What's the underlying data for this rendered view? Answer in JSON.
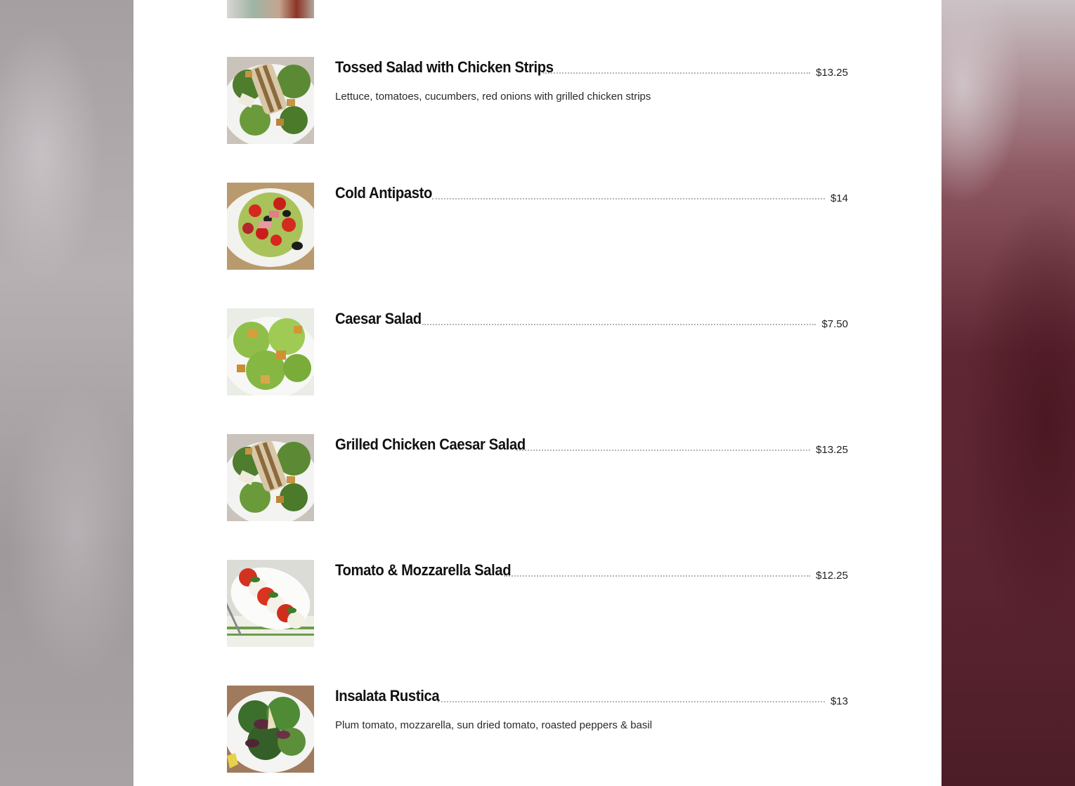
{
  "menu": {
    "items": [
      {
        "name": "Tossed Salad with Chicken Strips",
        "price": "$13.25",
        "description": "Lettuce, tomatoes, cucumbers, red onions with grilled chicken strips",
        "image": "chicken-caesar-photo"
      },
      {
        "name": "Cold Antipasto",
        "price": "$14",
        "description": "",
        "image": "antipasto-photo"
      },
      {
        "name": "Caesar Salad",
        "price": "$7.50",
        "description": "",
        "image": "caesar-salad-photo"
      },
      {
        "name": "Grilled Chicken Caesar Salad",
        "price": "$13.25",
        "description": "",
        "image": "chicken-caesar-photo"
      },
      {
        "name": "Tomato & Mozzarella Salad",
        "price": "$12.25",
        "description": "",
        "image": "caprese-photo"
      },
      {
        "name": "Insalata Rustica",
        "price": "$13",
        "description": "Plum tomato, mozzarella, sun dried tomato, roasted peppers & basil",
        "image": "mixed-greens-photo"
      }
    ]
  },
  "colors": {
    "panel": "#ffffff",
    "text": "#111111",
    "dots": "#b4b4b4"
  }
}
